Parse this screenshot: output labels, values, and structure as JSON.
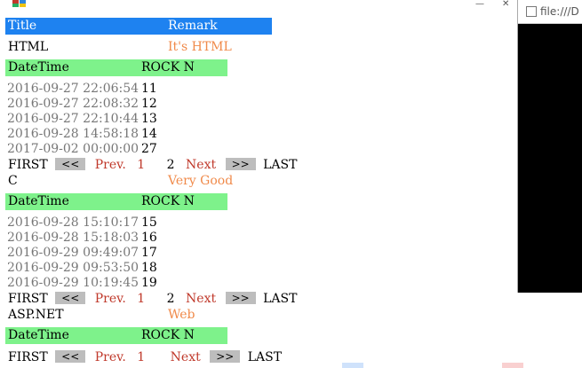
{
  "header": {
    "title_col": "Title",
    "remark_col": "Remark"
  },
  "groups": [
    {
      "title": "HTML",
      "remark": "It's HTML",
      "table_headers": [
        "DateTime",
        "ROCK N"
      ],
      "rows": [
        [
          "2016-09-27 22:06:54",
          "11"
        ],
        [
          "2016-09-27 22:08:32",
          "12"
        ],
        [
          "2016-09-27 22:10:44",
          "13"
        ],
        [
          "2016-09-28 14:58:18",
          "14"
        ],
        [
          "2017-09-02 00:00:00",
          "27"
        ]
      ]
    },
    {
      "title": "C",
      "remark": "Very Good",
      "table_headers": [
        "DateTime",
        "ROCK N"
      ],
      "rows": [
        [
          "2016-09-28 15:10:17",
          "15"
        ],
        [
          "2016-09-28 15:18:03",
          "16"
        ],
        [
          "2016-09-29 09:49:07",
          "17"
        ],
        [
          "2016-09-29 09:53:50",
          "18"
        ],
        [
          "2016-09-29 10:19:45",
          "19"
        ]
      ]
    },
    {
      "title": "ASP.NET",
      "remark": "Web",
      "table_headers": [
        "DateTime",
        "ROCK N"
      ],
      "rows": []
    }
  ],
  "pager": {
    "first": "FIRST",
    "prev_btn": "<<",
    "prev": "Prev.",
    "page1": "1",
    "page2": "2",
    "next": "Next",
    "next_btn": ">>",
    "last": "LAST"
  },
  "browser": {
    "address": "file:///D"
  },
  "colors": {
    "header_blue": "#1e82f0",
    "header_green": "#7ef28b",
    "remark_orange": "#f08a4a",
    "pager_red": "#c0392b"
  }
}
